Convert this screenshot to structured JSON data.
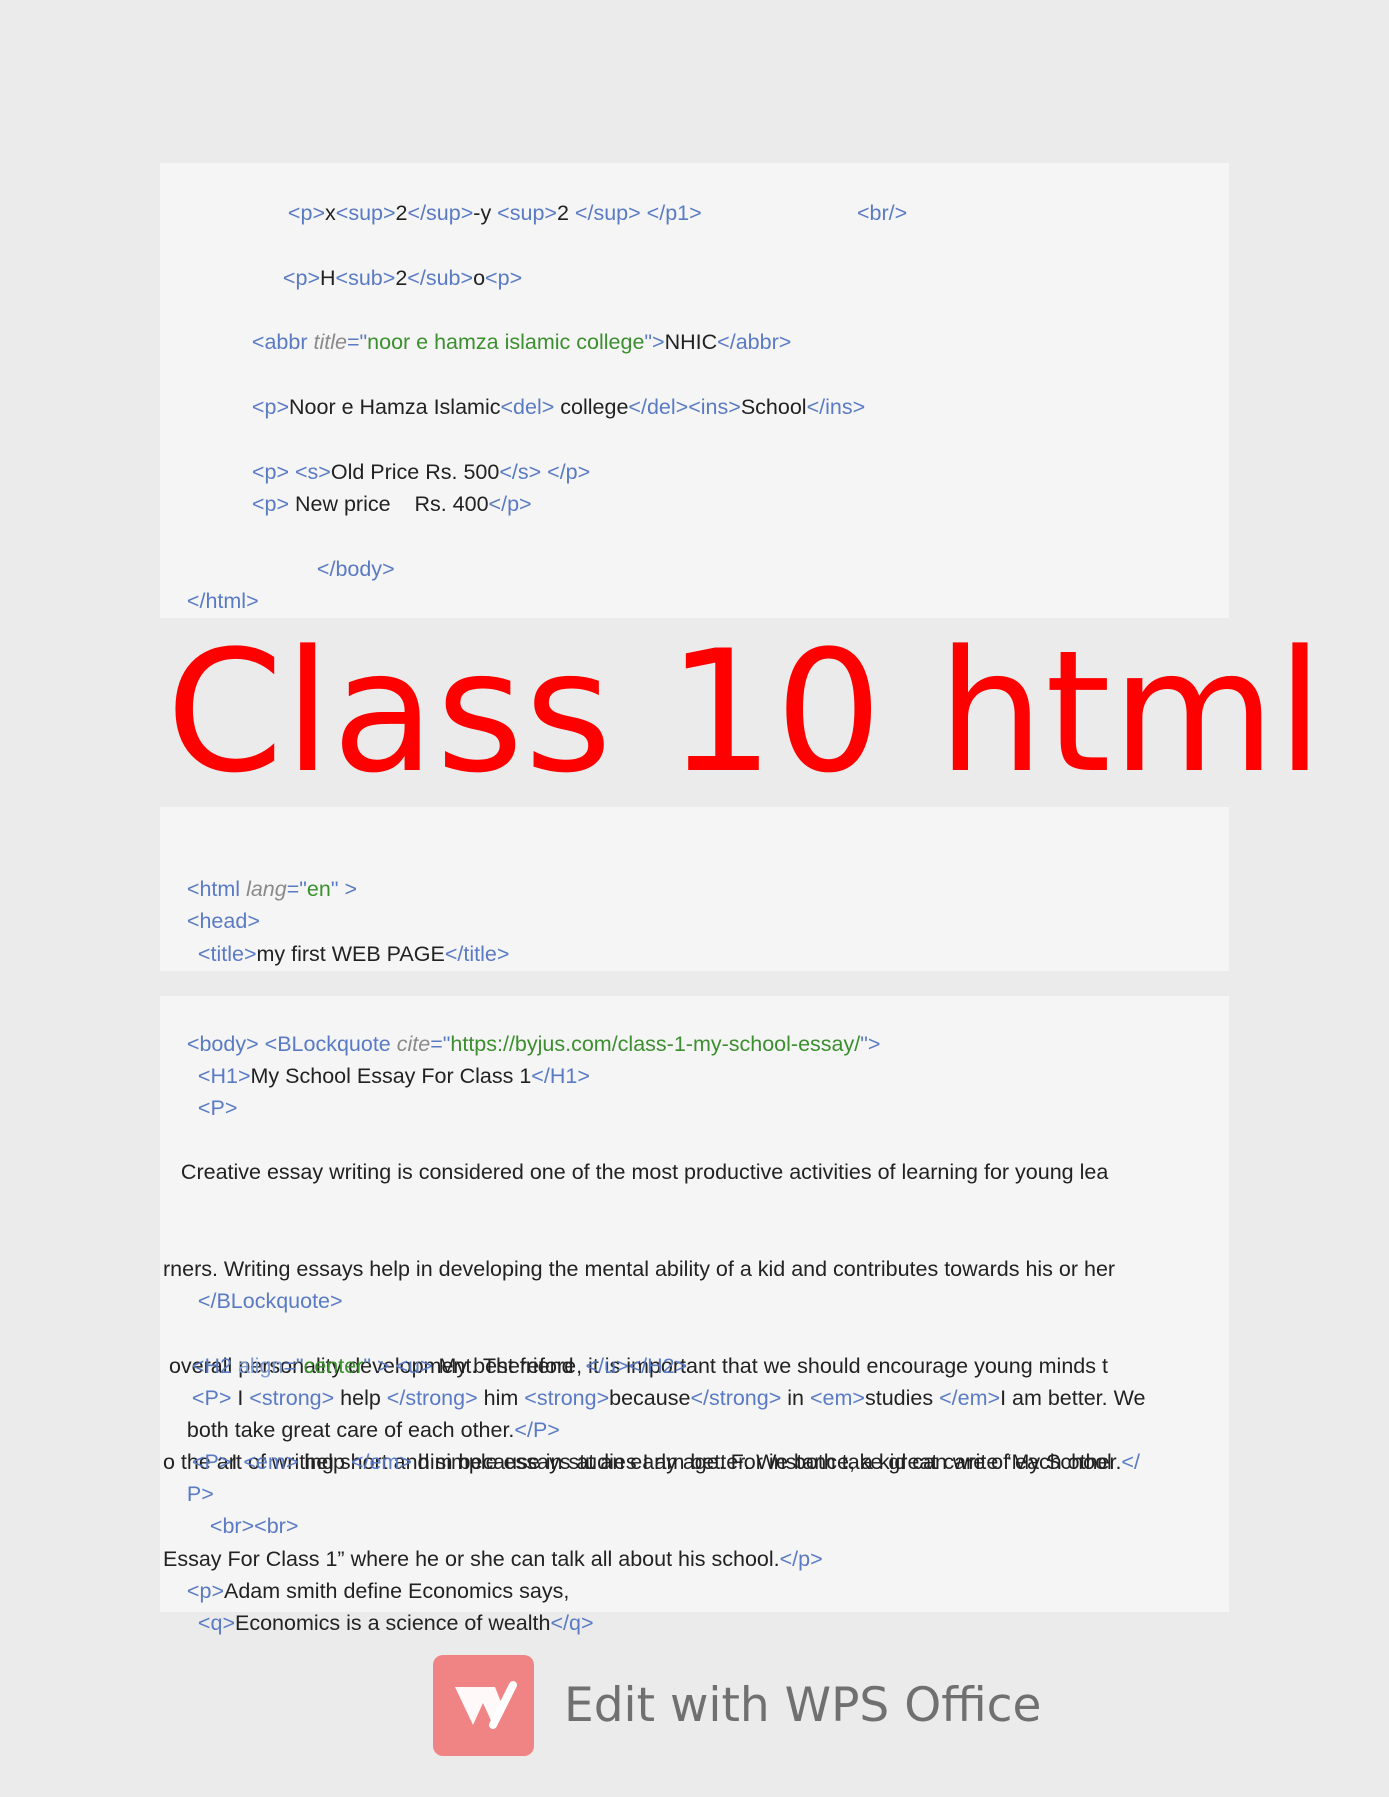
{
  "block1": {
    "line1": [
      "<",
      "p",
      ">",
      "x",
      "<",
      "sup",
      ">",
      "2",
      "</",
      "sup",
      ">",
      "-y ",
      "<",
      "sup",
      ">",
      "2 ",
      "</",
      "sup",
      ">",
      " ",
      "</",
      "p1",
      ">",
      "                          ",
      "<",
      "br",
      "/>"
    ],
    "line2": [
      "<",
      "p",
      ">",
      "H",
      "<",
      "sub",
      ">",
      "2",
      "</",
      "sub",
      ">",
      "o",
      "<",
      "p",
      ">"
    ],
    "line3": [
      "<",
      "abbr ",
      "title",
      "=\"",
      "noor e hamza islamic college",
      "\">",
      "NHIC",
      "</",
      "abbr",
      ">"
    ],
    "line4": [
      "<",
      "p",
      ">",
      "Noor e Hamza Islamic",
      "<",
      "del",
      ">",
      " college",
      "</",
      "del",
      "><",
      "ins",
      ">",
      "School",
      "</",
      "ins",
      ">"
    ],
    "line5": [
      "<",
      "p",
      "> <",
      "s",
      ">",
      "Old Price Rs. 500",
      "</",
      "s",
      "> </",
      "p",
      ">"
    ],
    "line6": [
      "<",
      "p",
      ">",
      " New price    Rs. 400",
      "</",
      "p",
      ">"
    ],
    "line7": [
      "</",
      "body",
      ">"
    ],
    "line8": [
      "</",
      "html",
      ">"
    ]
  },
  "title": "Class 10 html",
  "block2": {
    "line1": [
      "<",
      "html ",
      "lang",
      "=\"",
      "en",
      "\" >"
    ],
    "line2": [
      "<",
      "head",
      ">"
    ],
    "line3": [
      "<",
      "title",
      ">",
      "my first WEB PAGE",
      "</",
      "title",
      ">"
    ]
  },
  "head_close": [
    "</",
    "head",
    ">"
  ],
  "block3": {
    "line1": [
      "<",
      "body",
      "> <",
      "BLockquote ",
      "cite",
      "=\"",
      "https://byjus.com/class-1-my-school-essay/",
      "\">"
    ],
    "line2": [
      "<",
      "H1",
      ">",
      "My School Essay For Class 1",
      "</",
      "H1",
      ">"
    ],
    "line3": [
      "<",
      "P",
      ">"
    ],
    "para_lines": [
      "   Creative essay writing is considered one of the most productive activities of learning for young lea",
      "rners. Writing essays help in developing the mental ability of a kid and contributes towards his or her",
      " overall personality development. Therefore, it is important that we should encourage young minds t",
      "o the art of writing short and simple essays at an early age. For instance, a kid can write “My School"
    ],
    "para_last": "Essay For Class 1” where he or she can talk all about his school.",
    "para_last_tag": [
      "</",
      "p",
      ">"
    ],
    "line_bq_close": [
      "</",
      "BLockquote",
      ">"
    ],
    "line_h2": [
      "<",
      "H2 ",
      "align",
      "=\"",
      "center",
      "\" > <",
      "u",
      ">",
      " My best friend  ",
      "</",
      "u",
      "></",
      "H2",
      ">"
    ],
    "line_p1a": [
      "<",
      "P",
      ">",
      " I ",
      "<",
      "strong",
      ">",
      " help ",
      "</",
      "strong",
      ">",
      " him ",
      "<",
      "strong",
      ">",
      "because",
      "</",
      "strong",
      ">",
      " in ",
      "<",
      "em",
      ">",
      "studies ",
      "</",
      "em",
      ">",
      "I am better. We"
    ],
    "line_p1b": [
      "both take great care of each other.",
      "</",
      "P",
      ">"
    ],
    "line_p2a": [
      "<",
      "P",
      ">",
      "I ",
      "<",
      "em",
      ">",
      " help ",
      "</",
      "em",
      ">",
      " him because in studies I am better. We both take great care of each other.",
      "</"
    ],
    "line_p2b": [
      "P",
      ">"
    ],
    "line_br": [
      "<",
      "br",
      "><",
      "br",
      ">"
    ],
    "line_adam": [
      "<",
      "p",
      ">",
      "Adam smith define Economics says,"
    ],
    "line_q": [
      "<",
      "q",
      ">",
      "Economics is a science of wealth",
      "</",
      "q",
      ">"
    ]
  },
  "watermark": {
    "logo_icon": "wps-logo-icon",
    "text": "Edit with WPS Office",
    "logo_color": "#f08484"
  }
}
